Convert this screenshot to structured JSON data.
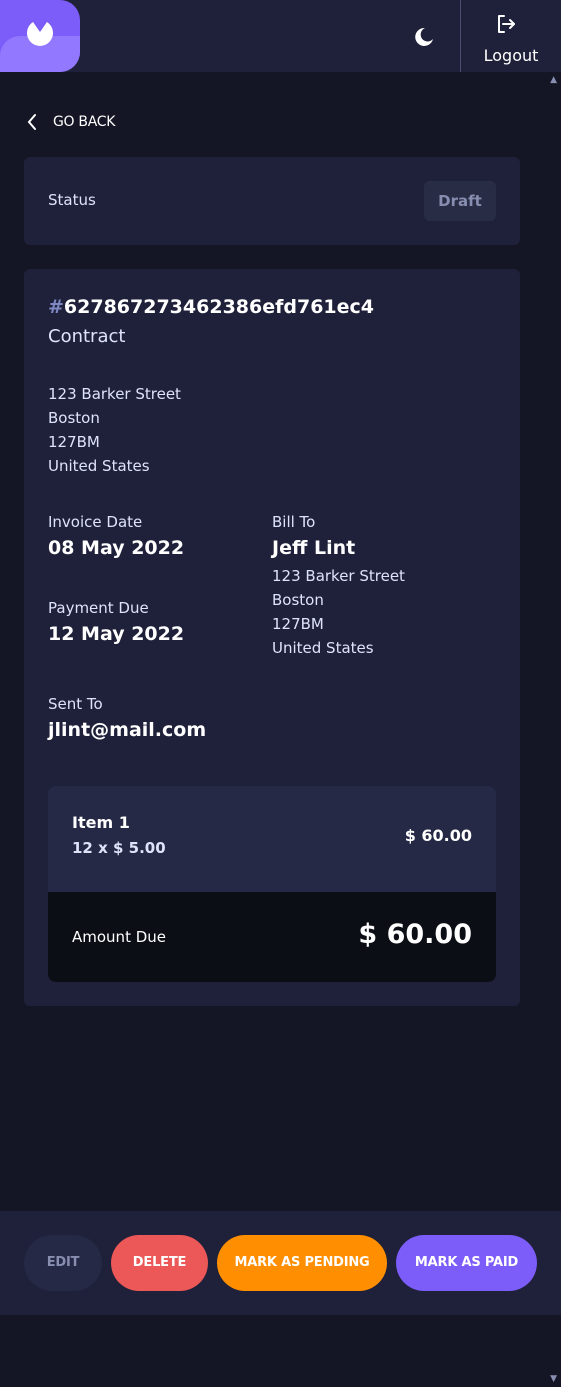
{
  "header": {
    "logo_icon": "brand-logo-icon",
    "theme_icon": "moon-icon",
    "logout_icon": "logout-icon",
    "logout_label": "Logout"
  },
  "nav": {
    "back_icon": "chevron-left-icon",
    "back_label": "GO BACK"
  },
  "status": {
    "label": "Status",
    "value": "Draft"
  },
  "invoice": {
    "hash": "#",
    "id": "627867273462386efd761ec4",
    "description": "Contract",
    "sender_address": {
      "street": "123 Barker Street",
      "city": "Boston",
      "post_code": "127BM",
      "country": "United States"
    },
    "invoice_date_label": "Invoice Date",
    "invoice_date": "08 May 2022",
    "payment_due_label": "Payment Due",
    "payment_due": "12 May 2022",
    "bill_to_label": "Bill To",
    "client_name": "Jeff Lint",
    "client_address": {
      "street": "123 Barker Street",
      "city": "Boston",
      "post_code": "127BM",
      "country": "United States"
    },
    "sent_to_label": "Sent To",
    "client_email": "jlint@mail.com",
    "items": [
      {
        "name": "Item 1",
        "qty_price": "12 x $ 5.00",
        "total": "$ 60.00"
      }
    ],
    "amount_due_label": "Amount Due",
    "amount_due": "$ 60.00"
  },
  "actions": {
    "edit": "EDIT",
    "delete": "DELETE",
    "mark_pending": "MARK AS PENDING",
    "mark_paid": "MARK AS PAID"
  },
  "colors": {
    "background": "#141625",
    "card": "#1e2139",
    "accent": "#7c5dfa",
    "danger": "#ec5757",
    "pending": "#ff8f00",
    "draft": "#888eb0"
  }
}
